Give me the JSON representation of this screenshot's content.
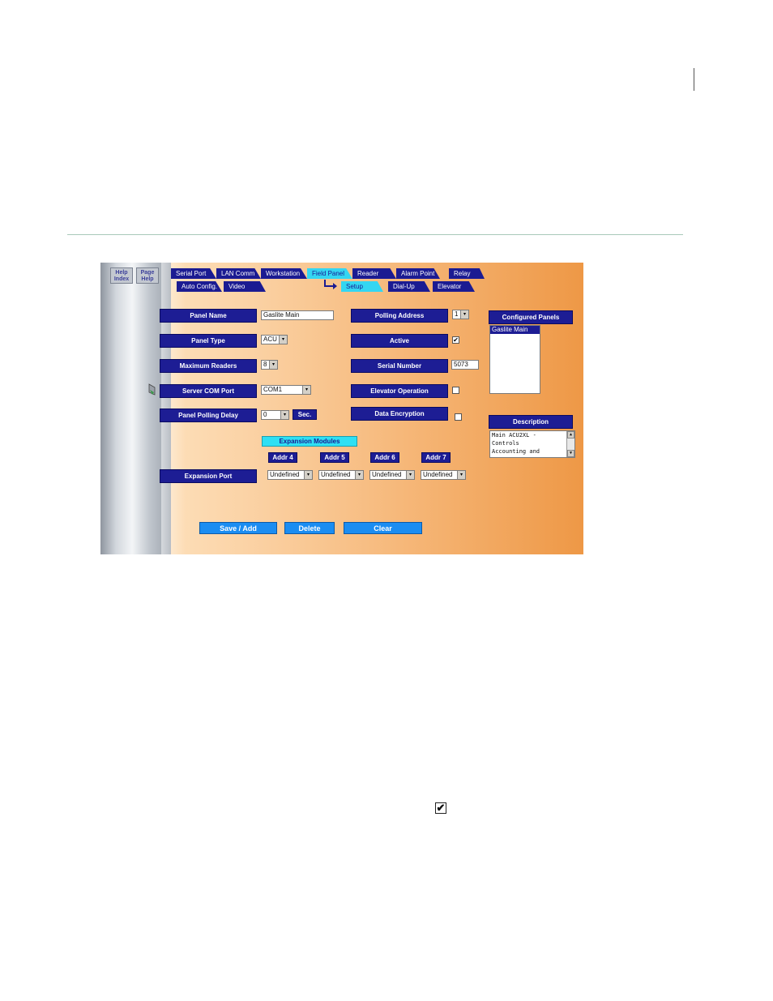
{
  "help_buttons": {
    "help_index": "Help Index",
    "page_help": "Page Help"
  },
  "tabs_row1": [
    "Serial Port",
    "LAN Comm",
    "Workstation",
    "Field Panel",
    "Reader",
    "Alarm Point",
    "Relay"
  ],
  "tabs_row2": [
    "Auto Config.",
    "Video"
  ],
  "subtabs": [
    "Setup",
    "Dial-Up",
    "Elevator"
  ],
  "active_tab": "Field Panel",
  "active_subtab": "Setup",
  "form": {
    "panel_name_label": "Panel Name",
    "panel_name_value": "Gaslite Main",
    "panel_type_label": "Panel Type",
    "panel_type_value": "ACU",
    "max_readers_label": "Maximum Readers",
    "max_readers_value": "8",
    "server_com_label": "Server COM Port",
    "server_com_value": "COM1",
    "polling_delay_label": "Panel Polling Delay",
    "polling_delay_value": "0",
    "polling_delay_unit": "Sec.",
    "polling_address_label": "Polling Address",
    "polling_address_value": "1",
    "active_label": "Active",
    "active_checked": true,
    "serial_number_label": "Serial Number",
    "serial_number_value": "5073",
    "elevator_label": "Elevator Operation",
    "elevator_checked": false,
    "encryption_label": "Data Encryption",
    "encryption_checked": false
  },
  "configured_panels": {
    "title": "Configured Panels",
    "items": [
      "Gaslite Main"
    ]
  },
  "description": {
    "title": "Description",
    "lines": [
      "Main ACU2XL -",
      "Controls",
      "Accounting and"
    ]
  },
  "expansion": {
    "title": "Expansion Modules",
    "port_label": "Expansion Port",
    "addrs": [
      {
        "label": "Addr 4",
        "value": "Undefined"
      },
      {
        "label": "Addr 5",
        "value": "Undefined"
      },
      {
        "label": "Addr 6",
        "value": "Undefined"
      },
      {
        "label": "Addr 7",
        "value": "Undefined"
      }
    ]
  },
  "actions": {
    "save": "Save / Add",
    "delete": "Delete",
    "clear": "Clear"
  },
  "glyphs": {
    "dropdown": "▾",
    "check": "✔",
    "big_check": "✔"
  },
  "colors": {
    "label_bg": "#1d1d94",
    "accent_cyan": "#34d6f2",
    "button_blue": "#1b8df2"
  }
}
